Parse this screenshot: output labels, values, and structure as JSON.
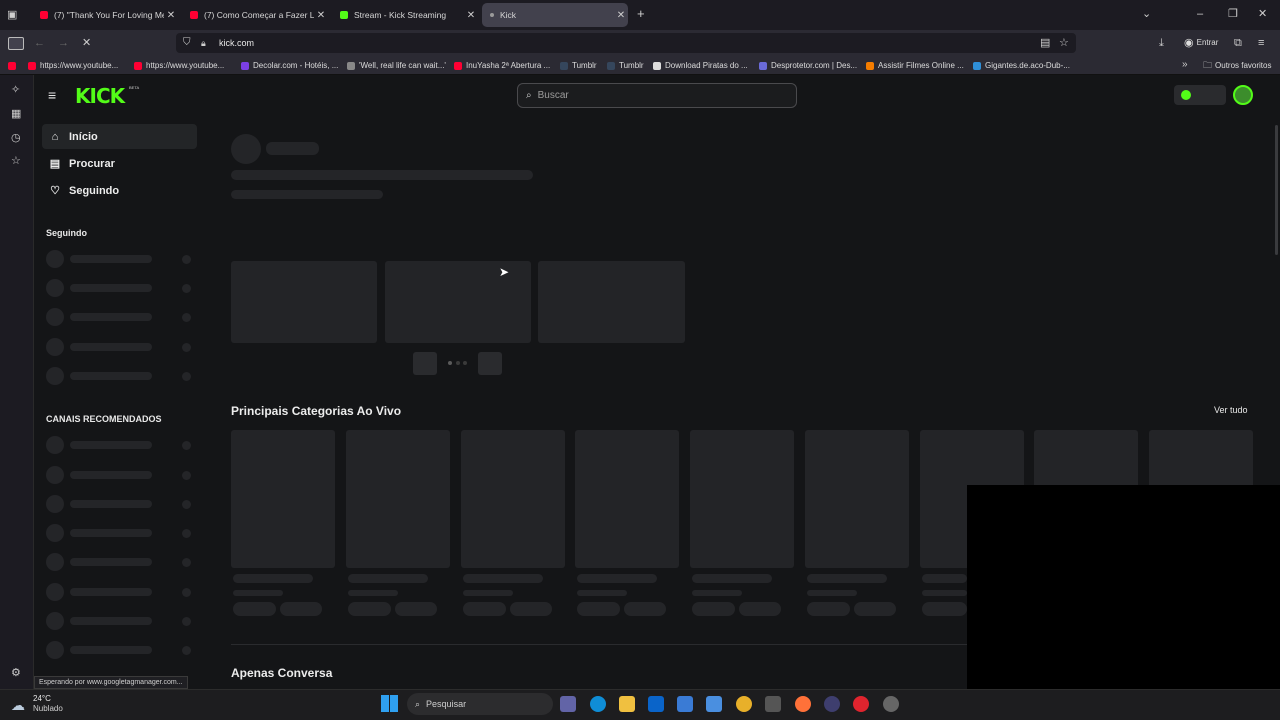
{
  "browser": {
    "tabs": [
      {
        "title": "(7) \"Thank You For Loving Me!\"",
        "color": "#ff0033",
        "active": false
      },
      {
        "title": "(7) Como Começar a Fazer Live",
        "color": "#ff0033",
        "active": false
      },
      {
        "title": "Stream - Kick Streaming",
        "color": "#53fc18",
        "active": false
      },
      {
        "title": "Kick",
        "color": "#9a9a9a",
        "active": true
      }
    ],
    "url": "kick.com",
    "signin_label": "Entrar",
    "bookmarks": [
      "https://www.youtube...",
      "https://www.youtube...",
      "Decolar.com - Hotéis, ...",
      "'Well, real life can wait...'",
      "InuYasha 2ª Abertura ...",
      "Tumblr",
      "Tumblr",
      "Download Piratas do ...",
      "Desprotetor.com | Des...",
      "Assistir Filmes Online ...",
      "Gigantes.de.aco-Dub-..."
    ],
    "other_bookmarks": "Outros favoritos",
    "status_text": "Esperando por www.googletagmanager.com..."
  },
  "kick": {
    "logo": "KICK",
    "logo_badge": "BETA",
    "search_placeholder": "Buscar",
    "nav": [
      {
        "label": "Início",
        "icon": "home-icon"
      },
      {
        "label": "Procurar",
        "icon": "browse-icon"
      },
      {
        "label": "Seguindo",
        "icon": "heart-icon"
      }
    ],
    "following_title": "Seguindo",
    "recommended_title": "CANAIS RECOMENDADOS",
    "categories_title": "Principais Categorias Ao Vivo",
    "see_all": "Ver tudo",
    "chat_title": "Apenas Conversa"
  },
  "taskbar": {
    "weather_temp": "24°C",
    "weather_desc": "Nublado",
    "search_label": "Pesquisar"
  },
  "colors": {
    "accent": "#53fc18",
    "background": "#141517"
  }
}
